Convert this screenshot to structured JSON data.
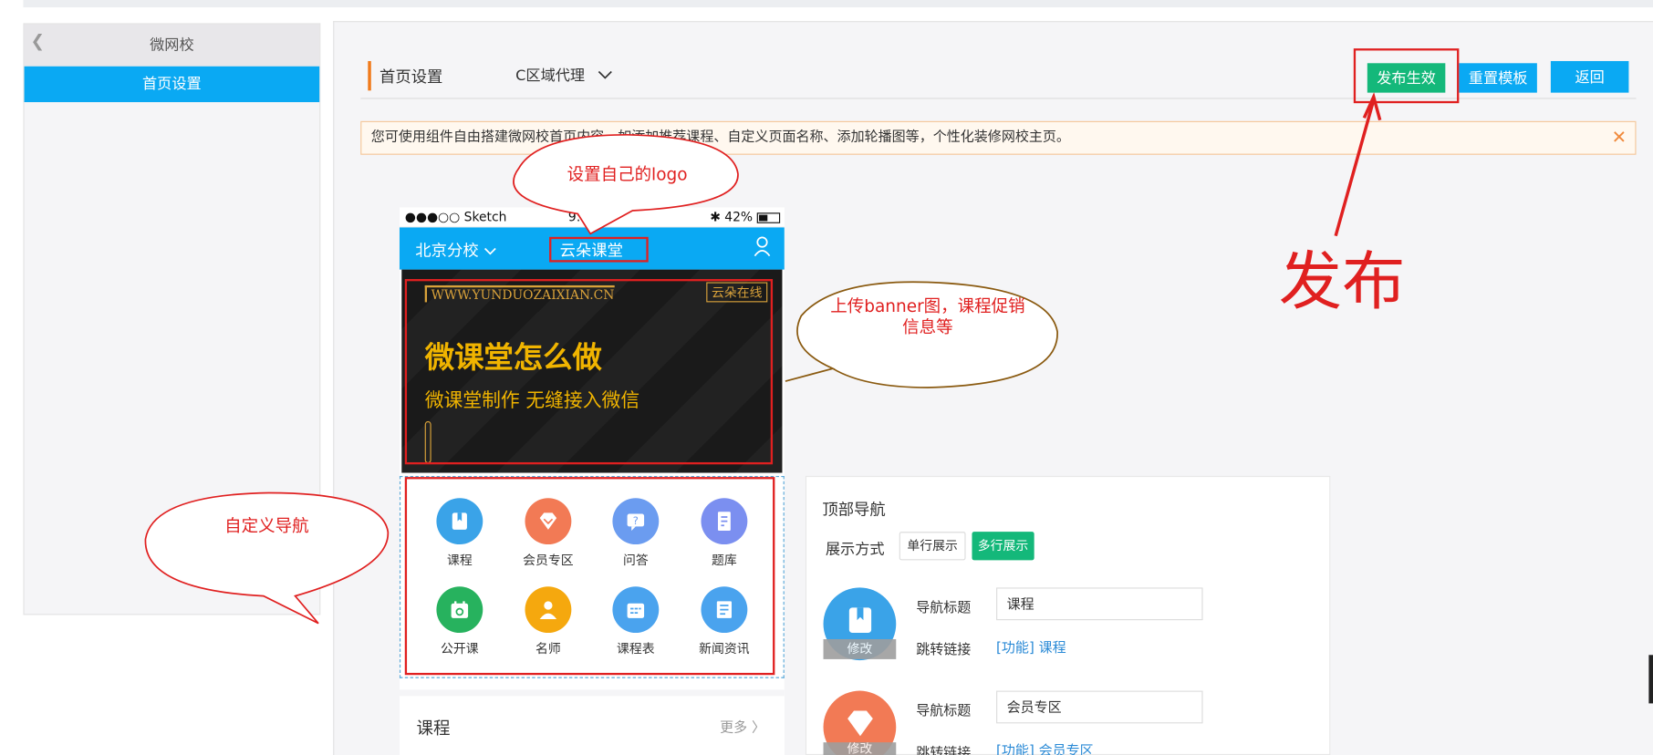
{
  "sidebar": {
    "title": "微网校",
    "items": [
      {
        "label": "首页设置"
      }
    ]
  },
  "header": {
    "title": "首页设置",
    "region_select": "C区域代理",
    "buttons": {
      "publish": "发布生效",
      "reset": "重置模板",
      "back": "返回"
    }
  },
  "notice": {
    "text": "您可使用组件自由搭建微网校首页内容，如添加推荐课程、自定义页面名称、添加轮播图等，个性化装修网校主页。"
  },
  "phone": {
    "status": {
      "carrier": "●●●○○ Sketch",
      "time": "9:41",
      "battery": "42%"
    },
    "nav": {
      "branch": "北京分校",
      "logo_text": "云朵课堂"
    },
    "banner": {
      "url": "WWW.YUNDUOZAIXIAN.CN",
      "tag": "云朵在线",
      "title": "微课堂怎么做",
      "subtitle": "微课堂制作  无缝接入微信"
    },
    "grid": [
      {
        "label": "课程",
        "color": "#3aa3e8",
        "icon": "book-icon"
      },
      {
        "label": "会员专区",
        "color": "#f27a55",
        "icon": "diamond-icon"
      },
      {
        "label": "问答",
        "color": "#6b9cf0",
        "icon": "question-icon"
      },
      {
        "label": "题库",
        "color": "#7b8ff0",
        "icon": "checklist-icon"
      },
      {
        "label": "公开课",
        "color": "#27b25e",
        "icon": "calendar-icon"
      },
      {
        "label": "名师",
        "color": "#f5a80e",
        "icon": "person-icon"
      },
      {
        "label": "课程表",
        "color": "#4aa3ee",
        "icon": "schedule-icon"
      },
      {
        "label": "新闻资讯",
        "color": "#4aa3ee",
        "icon": "news-icon"
      }
    ],
    "course": {
      "title": "课程",
      "more": "更多 〉"
    }
  },
  "panel": {
    "title": "顶部导航",
    "mode_label": "展示方式",
    "mode_single": "单行展示",
    "mode_multi": "多行展示",
    "edit": "修改",
    "title_label": "导航标题",
    "link_label": "跳转链接",
    "items": [
      {
        "title": "课程",
        "link": "[功能] 课程"
      },
      {
        "title": "会员专区",
        "link": "[功能] 会员专区"
      }
    ]
  },
  "annotations": {
    "logo": "设置自己的logo",
    "banner": "上传banner图，课程促销信息等",
    "nav": "自定义导航",
    "publish": "发布"
  }
}
